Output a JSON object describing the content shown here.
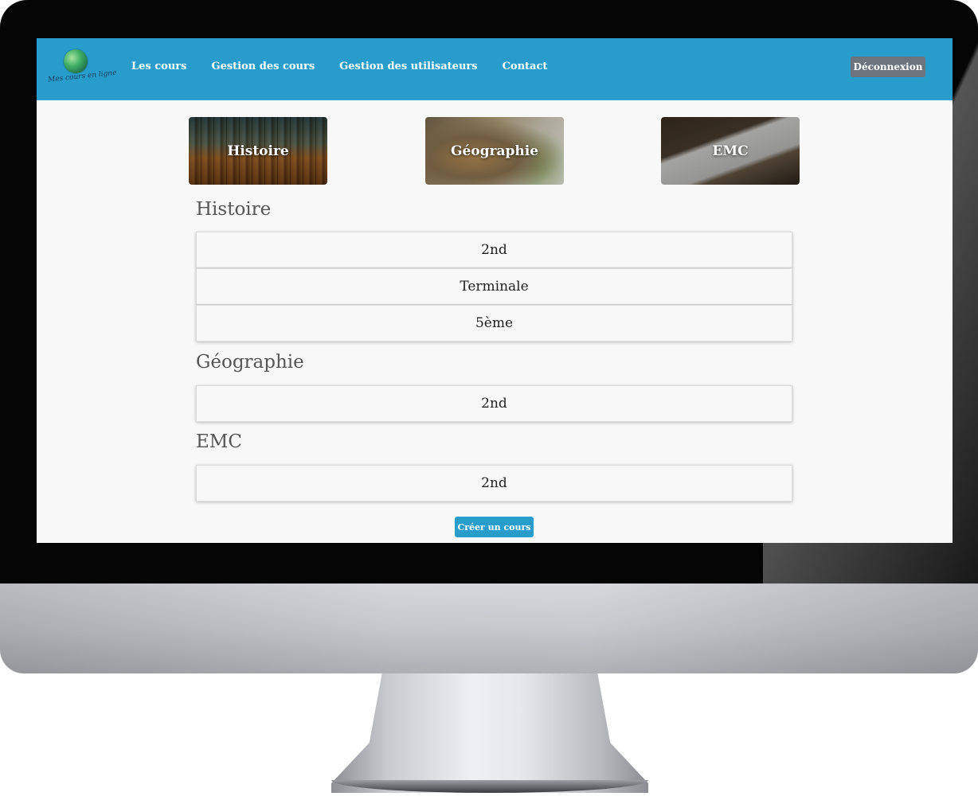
{
  "navbar": {
    "logo_text": "Mes cours en ligne",
    "links": [
      "Les cours",
      "Gestion des cours",
      "Gestion des utilisateurs",
      "Contact"
    ],
    "logout_label": "Déconnexion",
    "color": "#289dcb"
  },
  "categories": [
    {
      "label": "Histoire"
    },
    {
      "label": "Géographie"
    },
    {
      "label": "EMC"
    }
  ],
  "sections": [
    {
      "title": "Histoire",
      "courses": [
        "2nd",
        "Terminale",
        "5ème"
      ]
    },
    {
      "title": "Géographie",
      "courses": [
        "2nd"
      ]
    },
    {
      "title": "EMC",
      "courses": [
        "2nd"
      ]
    }
  ],
  "create_button_label": "Créer un cours",
  "colors": {
    "accent": "#289dcb",
    "logout_button": "#6c757d",
    "page_background": "#f8f8f8"
  }
}
